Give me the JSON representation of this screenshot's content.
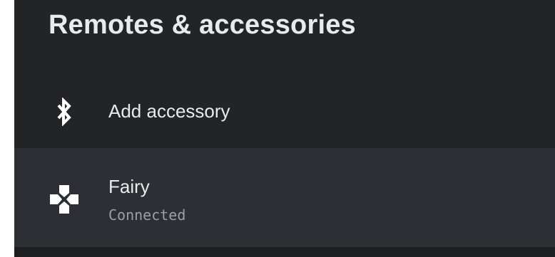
{
  "header": {
    "title": "Remotes & accessories"
  },
  "items": [
    {
      "icon": "bluetooth-icon",
      "label": "Add accessory"
    },
    {
      "icon": "gamepad-icon",
      "label": "Fairy",
      "status": "Connected"
    }
  ],
  "colors": {
    "background": "#222426",
    "selected_row": "#2c2f33",
    "primary_text": "#e8eaed",
    "secondary_text": "#9aa0a6"
  }
}
